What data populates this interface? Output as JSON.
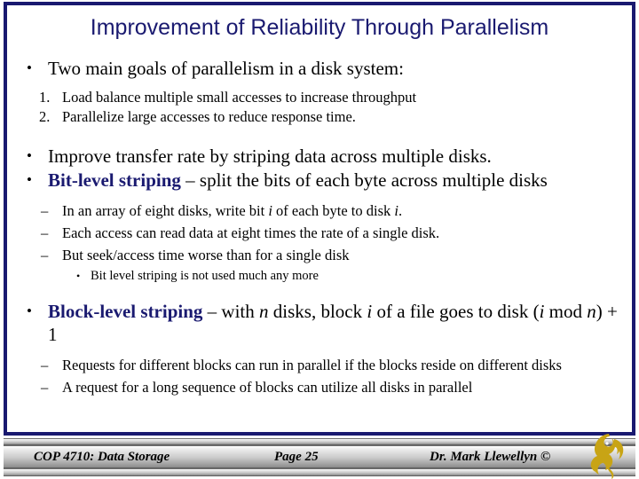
{
  "slide": {
    "title": "Improvement of Reliability Through Parallelism",
    "accent_color": "#1a1a70",
    "background_color": "#ffffff",
    "border_color": "#191970",
    "logo_color": "#c8a415"
  },
  "body": {
    "b1": {
      "marker": "•",
      "text": "Two main goals of parallelism in a disk system:"
    },
    "n1": {
      "marker": "1.",
      "text": "Load balance multiple small accesses to increase throughput"
    },
    "n2": {
      "marker": "2.",
      "text": "Parallelize large accesses to reduce response time."
    },
    "b2": {
      "marker": "•",
      "text": "Improve transfer rate by striping data across multiple disks."
    },
    "b3": {
      "marker": "•",
      "keyword": "Bit-level striping",
      "rest": " – split the bits of each byte across multiple disks"
    },
    "s1": {
      "marker": "–",
      "pre": "In an array of eight disks, write bit ",
      "var1": "i",
      "mid": " of each byte to disk ",
      "var2": "i",
      "post": "."
    },
    "s2": {
      "marker": "–",
      "text": "Each access can read data at eight times the rate of a single disk."
    },
    "s3": {
      "marker": "–",
      "text": "But seek/access time worse than for a single disk"
    },
    "s4": {
      "marker": "•",
      "text": "Bit level striping is not used much any more"
    },
    "b4": {
      "marker": "•",
      "keyword": "Block-level striping",
      "pre": " – with ",
      "var1": "n",
      "mid1": " disks, block ",
      "var2": "i",
      "mid2": " of a file goes to disk (",
      "var3": "i",
      "mid3": " mod ",
      "var4": "n",
      "post": ") + 1"
    },
    "s5": {
      "marker": "–",
      "text": "Requests for different blocks can run in parallel if the blocks reside on different disks"
    },
    "s6": {
      "marker": "–",
      "text": "A request for a long sequence of blocks can utilize all disks in parallel"
    }
  },
  "footer": {
    "course": "COP 4710: Data Storage",
    "page": "Page 25",
    "author": "Dr. Mark Llewellyn ©"
  }
}
